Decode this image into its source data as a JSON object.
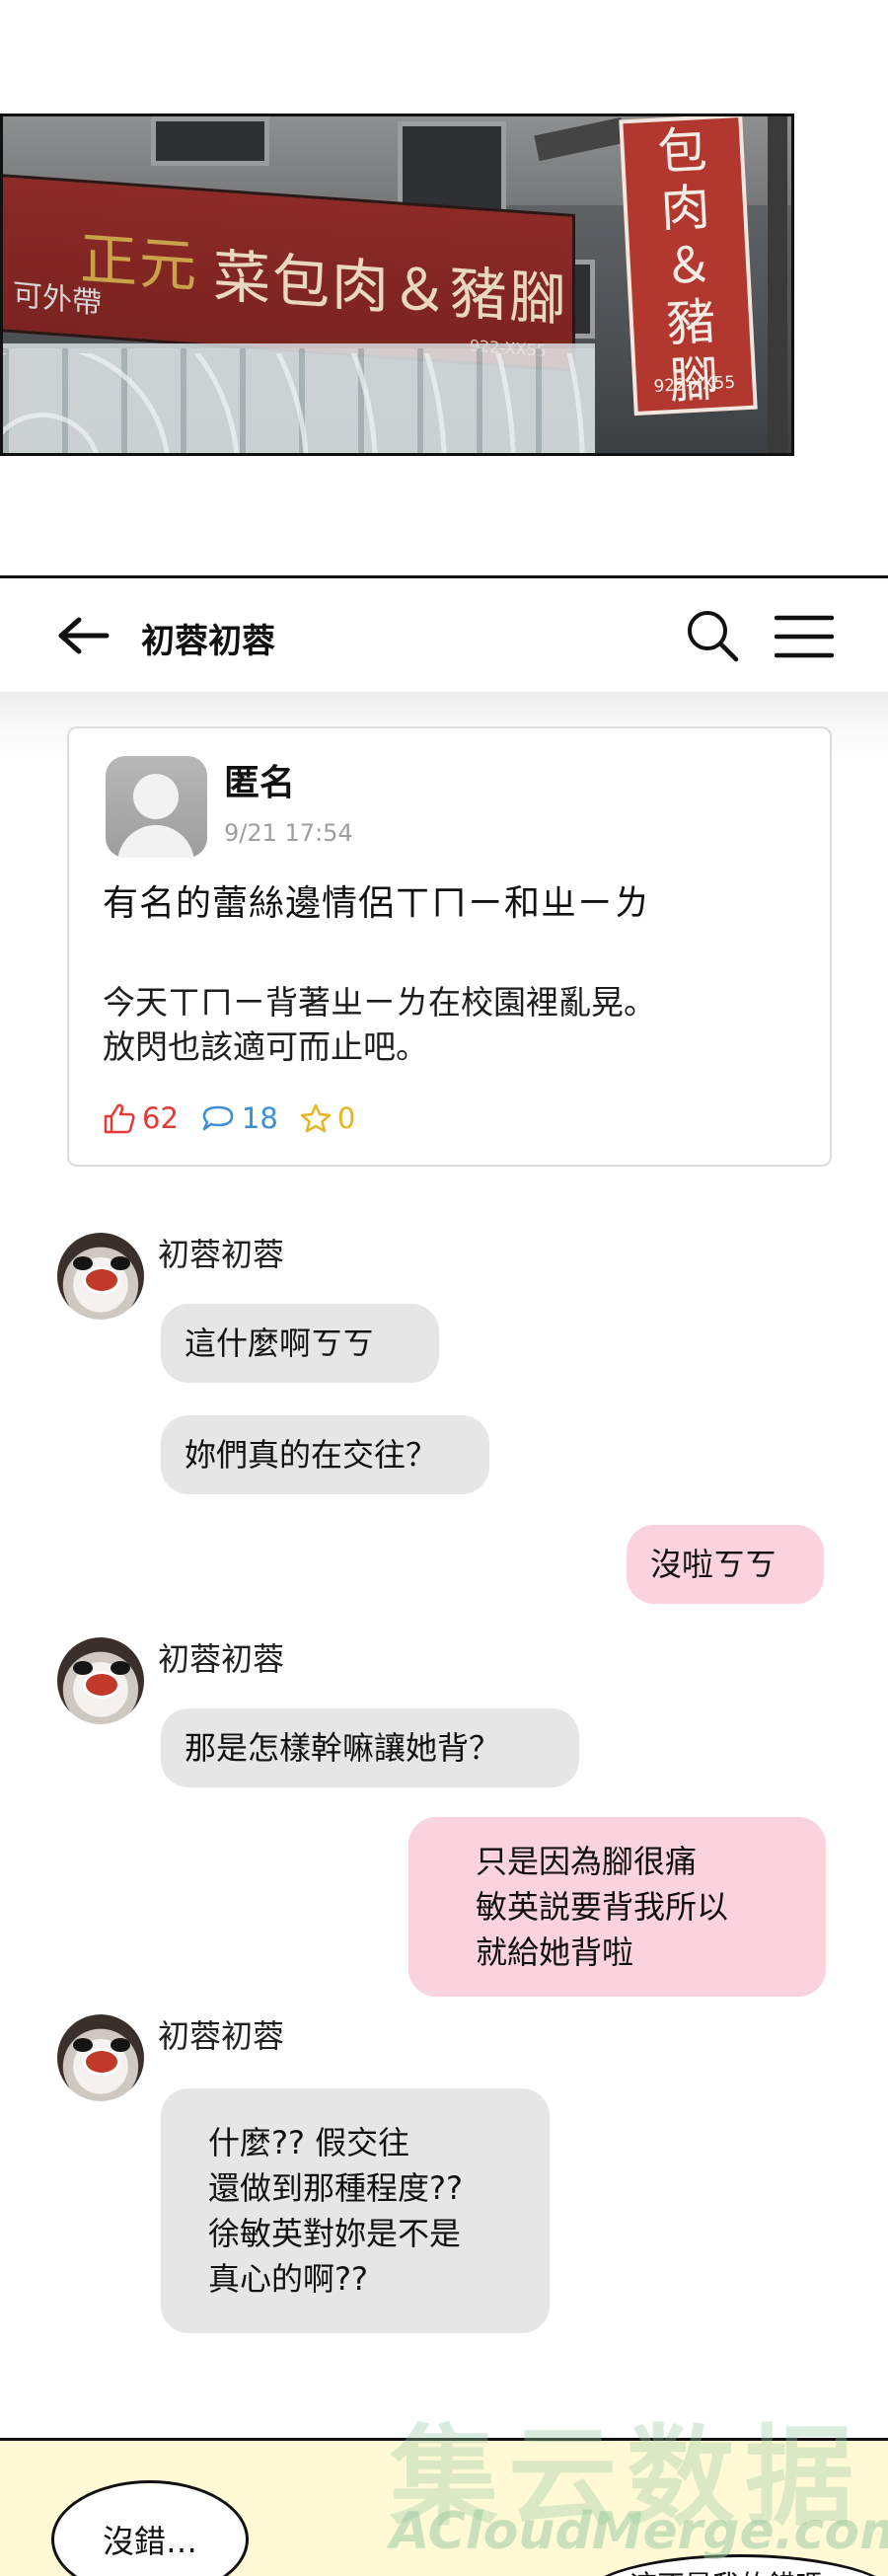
{
  "street_panel": {
    "sign_brand": "正元",
    "sign_name": "菜包肉＆豬腳",
    "sign_phone_small": "922-XX55",
    "sign_faded": "可外帶",
    "vertical_sign_text": "包\n肉\n＆\n豬\n腳",
    "vertical_sign_phone": "922-XX55"
  },
  "app_header": {
    "title": "初蓉初蓉",
    "back_icon": "arrow-left-icon",
    "search_icon": "search-icon",
    "menu_icon": "menu-icon"
  },
  "post": {
    "author": "匿名",
    "timestamp": "9/21 17:54",
    "title": "有名的蕾絲邊情侶ㄒㄇㄧ和ㄓㄧㄌ",
    "body_line1": "今天ㄒㄇㄧ背著ㄓㄧㄌ在校園裡亂晃。",
    "body_line2": "放閃也該適可而止吧。",
    "likes": "62",
    "comments": "18",
    "stars": "0",
    "colors": {
      "like": "#e53935",
      "comment": "#3b8fd6",
      "star": "#e6b422"
    }
  },
  "chat": {
    "sender_name": "初蓉初蓉",
    "messages": [
      {
        "side": "in",
        "text": "這什麼啊ㄎㄎ"
      },
      {
        "side": "in",
        "text": "妳們真的在交往？"
      },
      {
        "side": "out",
        "text": "沒啦ㄎㄎ"
      },
      {
        "side": "in",
        "text": "那是怎樣幹嘛讓她背？"
      },
      {
        "side": "out",
        "text": "只是因為腳很痛\n敏英説要背我所以\n就給她背啦"
      },
      {
        "side": "in",
        "text": "什麼?? 假交往\n還做到那種程度??\n徐敏英對妳是不是\n真心的啊??"
      }
    ],
    "colors": {
      "incoming": "#e6e6e6",
      "outgoing": "#fbd3dc"
    }
  },
  "bottom_panel": {
    "speech_1": "沒錯…",
    "speech_2": "這不是我的錯嗎…",
    "watermark_cn": "集云数据",
    "watermark_en": "ACloudMerge.com"
  }
}
